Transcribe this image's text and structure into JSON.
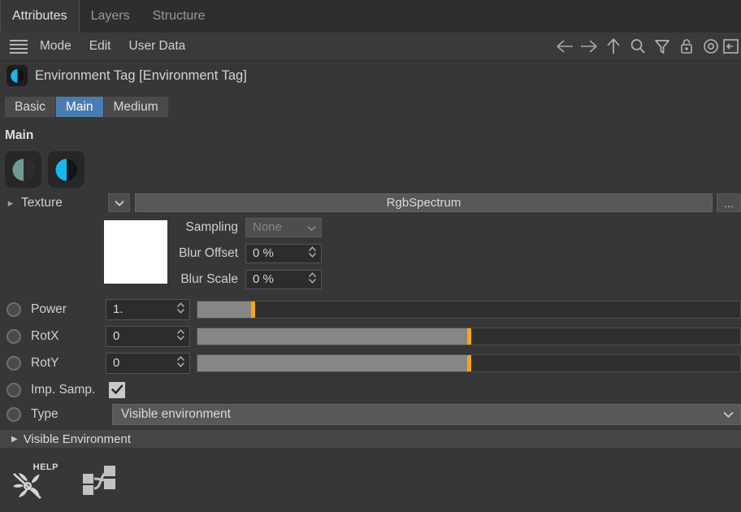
{
  "window": {
    "tabs": [
      {
        "label": "Attributes",
        "active": true
      },
      {
        "label": "Layers",
        "active": false
      },
      {
        "label": "Structure",
        "active": false
      }
    ]
  },
  "menubar": {
    "hamburger_icon": "hamburger-menu-icon",
    "items": [
      "Mode",
      "Edit",
      "User Data"
    ],
    "toolbar_icons": [
      "arrow-left-icon",
      "arrow-right-icon",
      "arrow-up-icon",
      "search-icon",
      "filter-icon",
      "lock-icon",
      "target-icon",
      "panel-arrow-icon"
    ]
  },
  "object": {
    "icon": "environment-tag-icon",
    "title": "Environment Tag [Environment Tag]"
  },
  "subtabs": [
    {
      "label": "Basic",
      "active": false
    },
    {
      "label": "Main",
      "active": true
    },
    {
      "label": "Medium",
      "active": false
    }
  ],
  "section": {
    "title": "Main"
  },
  "env_buttons": [
    {
      "name": "environment-inactive-button",
      "color": "#6f9b95",
      "active": false
    },
    {
      "name": "environment-active-button",
      "color": "#16b8ec",
      "active": true
    }
  ],
  "texture": {
    "expand_icon": "chevron-right-icon",
    "label": "Texture",
    "dropdown_icon": "chevron-down-icon",
    "value": "RgbSpectrum",
    "more_label": "...",
    "swatch_color": "#ffffff"
  },
  "sampling": {
    "label": "Sampling",
    "value": "None",
    "disabled": true,
    "chevron_icon": "chevron-down-icon"
  },
  "blur_offset": {
    "label": "Blur Offset",
    "value": "0 %",
    "spinner_icon": "spinner-updown-icon"
  },
  "blur_scale": {
    "label": "Blur Scale",
    "value": "0 %",
    "spinner_icon": "spinner-updown-icon"
  },
  "params": [
    {
      "name": "power",
      "label": "Power",
      "value": "1.",
      "keyframe_icon": "keyframe-dot-icon",
      "slider_percent": 10.2,
      "slider_color": "#f5a716"
    },
    {
      "name": "rotx",
      "label": "RotX",
      "value": "0",
      "keyframe_icon": "keyframe-dot-icon",
      "slider_percent": 50.0,
      "slider_color": "#f5a716"
    },
    {
      "name": "roty",
      "label": "RotY",
      "value": "0",
      "keyframe_icon": "keyframe-dot-icon",
      "slider_percent": 50.0,
      "slider_color": "#f5a716"
    }
  ],
  "imp_samp": {
    "label": "Imp. Samp.",
    "checked": true,
    "keyframe_icon": "keyframe-dot-icon",
    "check_icon": "checkmark-icon"
  },
  "type_row": {
    "label": "Type",
    "value": "Visible environment",
    "keyframe_icon": "keyframe-dot-icon",
    "chevron_icon": "chevron-down-icon"
  },
  "group": {
    "triangle_icon": "triangle-right-icon",
    "label": "Visible Environment"
  },
  "footer": {
    "help_icon": "octane-help-icon",
    "help_label": "HELP",
    "node_icon": "node-graph-icon"
  }
}
